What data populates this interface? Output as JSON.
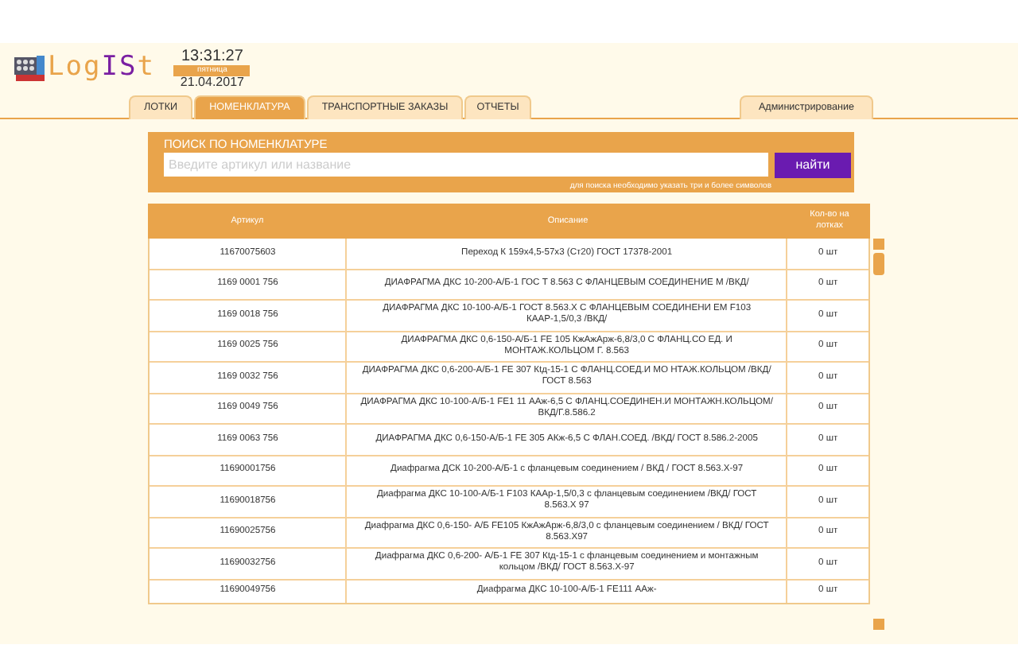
{
  "logo": {
    "part_1": "Log",
    "part_2": "IS",
    "part_3": "t"
  },
  "clock": {
    "time": "13:31:27",
    "weekday": "пятница",
    "date": "21.04.2017"
  },
  "tabs": [
    {
      "label": "ЛОТКИ",
      "selected": false
    },
    {
      "label": "НОМЕНКЛАТУРА",
      "selected": true
    },
    {
      "label": "ТРАНСПОРТНЫЕ ЗАКАЗЫ",
      "selected": false
    },
    {
      "label": "ОТЧЕТЫ",
      "selected": false
    }
  ],
  "admin_tab": {
    "label": "Администрирование",
    "selected": false
  },
  "search": {
    "title": "ПОИСК ПО НОМЕНКЛАТУРЕ",
    "placeholder": "Введите артикул или название",
    "button": "найти",
    "hint": "для поиска необходимо указать три и более символов"
  },
  "table": {
    "columns": [
      "Артикул",
      "Описание",
      "Кол-во на лотках"
    ],
    "rows": [
      [
        "11670075603",
        "Переход К 159х4,5-57х3 (Ст20) ГОСТ 17378-2001",
        "0 шт"
      ],
      [
        "1169 0001 756",
        "ДИАФРАГМА ДКС 10-200-А/Б-1 ГОС Т 8.563 С ФЛАНЦЕВЫМ СОЕДИНЕНИЕ М /ВКД/",
        "0 шт"
      ],
      [
        "1169 0018 756",
        "ДИАФРАГМА ДКС 10-100-А/Б-1 ГОСТ  8.563.Х С ФЛАНЦЕВЫМ СОЕДИНЕНИ ЕМ F103 КААР-1,5/0,3 /ВКД/",
        "0 шт"
      ],
      [
        "1169 0025 756",
        "ДИАФРАГМА ДКС 0,6-150-А/Б-1 FE  105 КжАжАрж-6,8/3,0 С ФЛАНЦ.СО ЕД. И МОНТАЖ.КОЛЬЦОМ Г. 8.563",
        "0 шт"
      ],
      [
        "1169 0032 756",
        "ДИАФРАГМА ДКС 0,6-200-А/Б-1 FE 307 Кtд-15-1 С ФЛАНЦ.СОЕД.И МО НТАЖ.КОЛЬЦОМ /ВКД/ГОСТ 8.563",
        "0 шт"
      ],
      [
        "1169 0049 756",
        "ДИАФРАГМА ДКС  10-100-А/Б-1 FE1 11 ААж-6,5 С ФЛАНЦ.СОЕДИНЕН.И МОНТАЖН.КОЛЬЦОМ/ВКД/Г.8.586.2",
        "0 шт"
      ],
      [
        "1169 0063 756",
        "ДИАФРАГМА ДКС 0,6-150-А/Б-1 FE 305 АКж-6,5 С ФЛАН.СОЕД. /ВКД/  ГОСТ 8.586.2-2005",
        "0 шт"
      ],
      [
        "11690001756",
        "Диафрагма ДСК 10-200-А/Б-1 с фланцевым соединением  / ВКД / ГОСТ 8.563.Х-97",
        "0 шт"
      ],
      [
        "11690018756",
        "Диафрагма ДКС 10-100-А/Б-1 F103 КААр-1,5/0,3 с фланцевым соединением /ВКД/ ГОСТ 8.563.Х 97",
        "0 шт"
      ],
      [
        "11690025756",
        "Диафрагма ДКС 0,6-150- А/Б FE105 КжАжАрж-6,8/3,0 с фланцевым соединением / ВКД/ ГОСТ 8.563.Х97",
        "0 шт"
      ],
      [
        "11690032756",
        "Диафрагма ДКС 0,6-200- А/Б-1 FE 307 Кtд-15-1 с фланцевым соединением и монтажным кольцом /ВКД/ ГОСТ 8.563.Х-97",
        "0 шт"
      ],
      [
        "11690049756",
        "Диафрагма ДКС 10-100-А/Б-1  FE111 ААж-",
        "0 шт"
      ]
    ]
  }
}
